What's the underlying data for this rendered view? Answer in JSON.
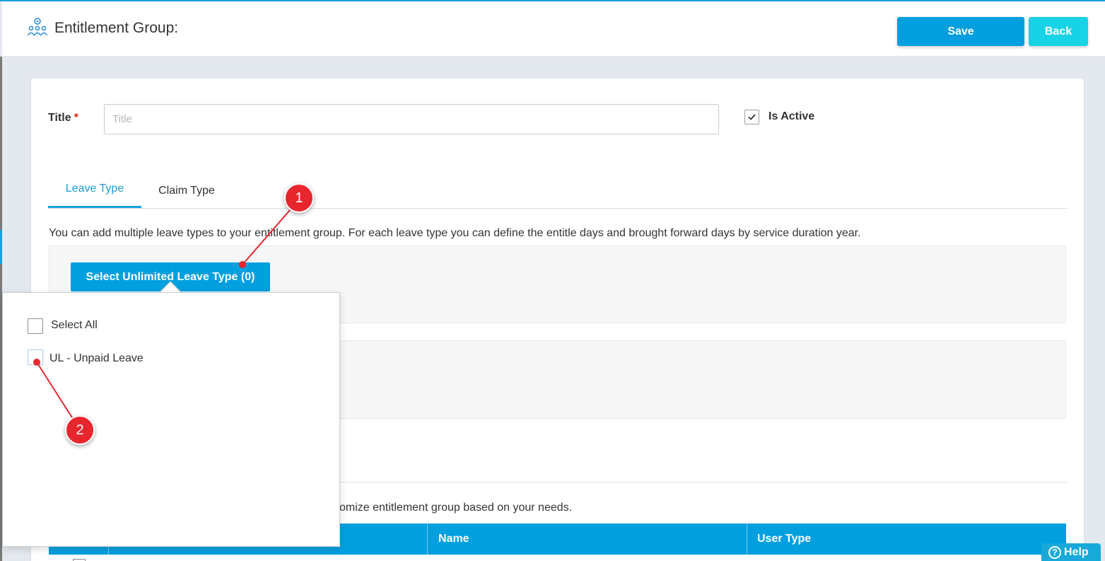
{
  "header": {
    "title": "Entitlement Group:",
    "icon": "group-settings-icon",
    "save_label": "Save",
    "back_label": "Back"
  },
  "form": {
    "title_label": "Title",
    "required_mark": "*",
    "title_placeholder": "Title",
    "title_value": "",
    "is_active_label": "Is Active",
    "is_active_checked": true
  },
  "tabs": [
    {
      "label": "Leave Type",
      "active": true
    },
    {
      "label": "Claim Type",
      "active": false
    }
  ],
  "leave_type": {
    "description": "You can add multiple leave types to your entitlement group. For each leave type you can define the entitle days and brought forward days by service duration year.",
    "select_unlimited_button": "Select Unlimited Leave Type (0)"
  },
  "popover": {
    "select_all_label": "Select All",
    "items": [
      {
        "label": "UL - Unpaid Leave",
        "checked": false
      }
    ]
  },
  "users": {
    "description_fragment": "omize entitlement group based on your needs.",
    "columns": [
      "",
      "",
      "Name",
      "User Type"
    ]
  },
  "annotations": {
    "callout_1": "1",
    "callout_2": "2"
  },
  "help": {
    "label": "Help",
    "icon_text": "?"
  },
  "colors": {
    "primary": "#029fdf",
    "back_button": "#17d3e6",
    "callout": "#e8262e"
  }
}
